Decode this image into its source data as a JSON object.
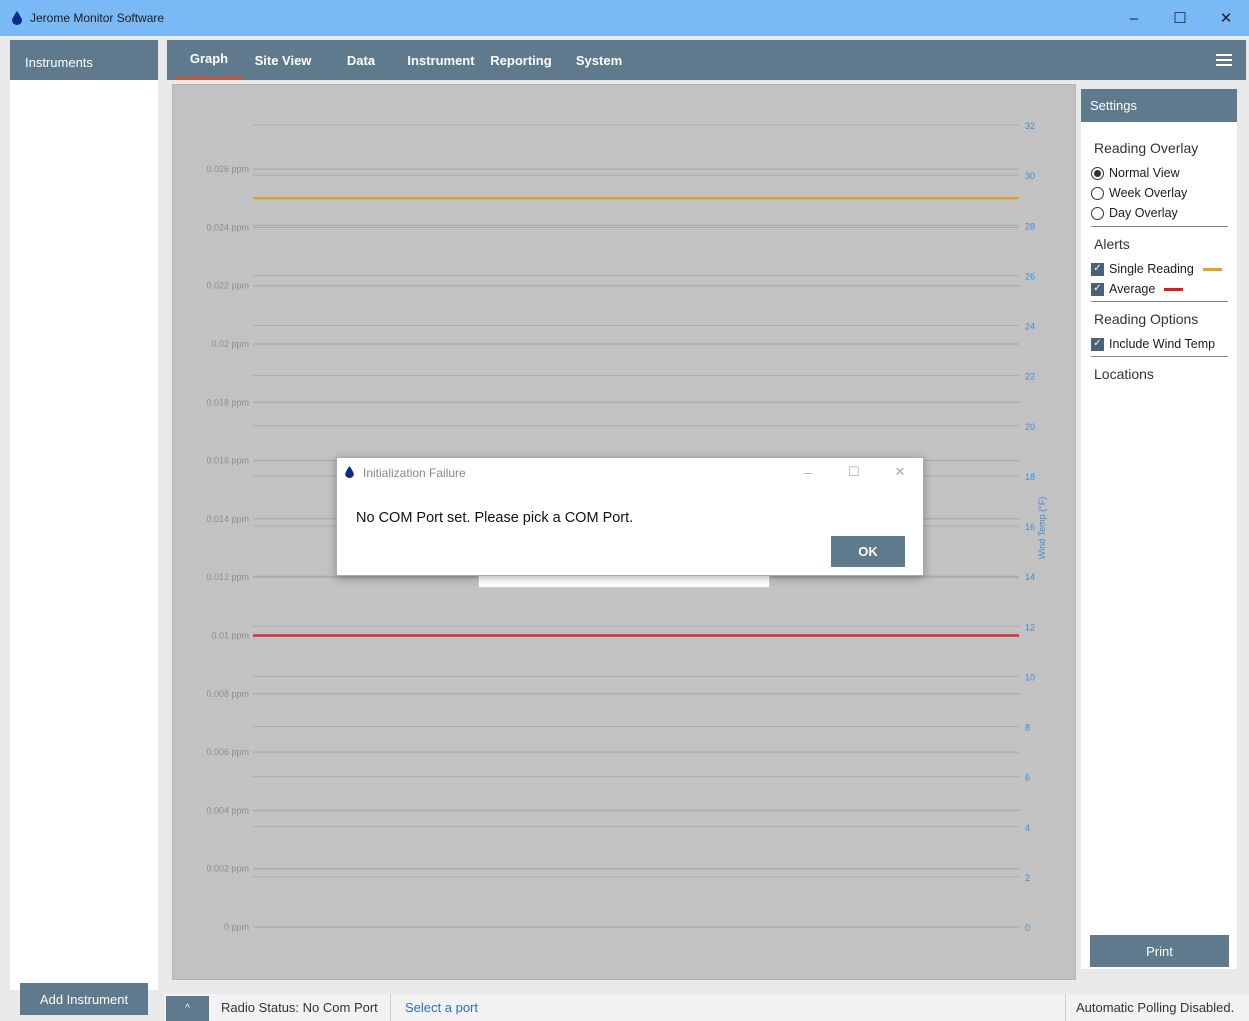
{
  "window": {
    "title": "Jerome Monitor Software",
    "controls": [
      "–",
      "☐",
      "✕"
    ]
  },
  "instruments": {
    "header": "Instruments",
    "add_button": "Add Instrument"
  },
  "tabs": [
    "Graph",
    "Site View",
    "Data",
    "Instrument",
    "Reporting",
    "System"
  ],
  "active_tab": "Graph",
  "settings": {
    "header": "Settings",
    "reading_overlay_title": "Reading Overlay",
    "overlay_options": [
      "Normal View",
      "Week Overlay",
      "Day Overlay"
    ],
    "selected_overlay": "Normal View",
    "alerts_title": "Alerts",
    "alerts": [
      {
        "label": "Single Reading",
        "checked": true,
        "color": "#e8a21e"
      },
      {
        "label": "Average",
        "checked": true,
        "color": "#e21c1c"
      }
    ],
    "reading_options_title": "Reading Options",
    "reading_options": [
      {
        "label": "Include Wind Temp",
        "checked": true
      }
    ],
    "locations_title": "Locations",
    "print_button": "Print"
  },
  "status": {
    "collapse_icon": "^",
    "radio_status": "Radio Status: No Com Port",
    "select_port": "Select a port",
    "polling": "Automatic Polling Disabled."
  },
  "dialog": {
    "title": "Initialization Failure",
    "message": "No COM Port set. Please pick a COM Port.",
    "ok_button": "OK"
  },
  "chart_data": {
    "type": "line",
    "left_axis_ticks": [
      "0 ppm",
      "0.002 ppm",
      "0.004 ppm",
      "0.006 ppm",
      "0.008 ppm",
      "0.01 ppm",
      "0.012 ppm",
      "0.014 ppm",
      "0.016 ppm",
      "0.018 ppm",
      "0.02 ppm",
      "0.022 ppm",
      "0.024 ppm",
      "0.026 ppm"
    ],
    "left_ylim": [
      0,
      0.028
    ],
    "right_axis_ticks": [
      "0",
      "2",
      "4",
      "6",
      "8",
      "10",
      "12",
      "14",
      "16",
      "18",
      "20",
      "22",
      "24",
      "26",
      "28",
      "30",
      "32"
    ],
    "right_ylim": [
      0,
      32
    ],
    "right_label": "Wind Temp (°F)",
    "series": [
      {
        "name": "Single Reading",
        "value": 0.025,
        "color": "#d9a53a"
      },
      {
        "name": "Average",
        "value": 0.01,
        "color": "#d0333a"
      }
    ],
    "grid": true
  }
}
